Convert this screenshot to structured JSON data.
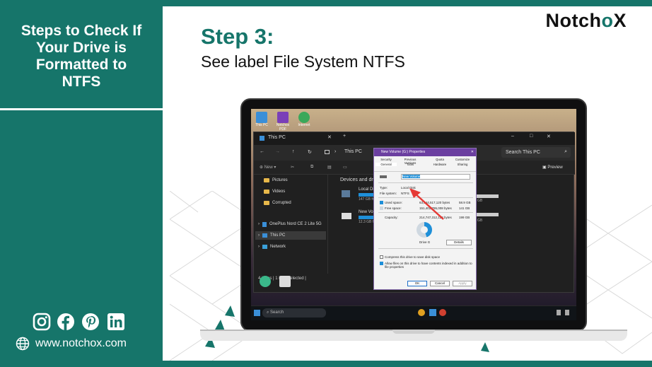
{
  "sidebar": {
    "title_lines": [
      "Steps to Check If",
      "Your Drive is",
      "Formatted to",
      "NTFS"
    ],
    "social_icons": [
      "instagram-icon",
      "facebook-icon",
      "pinterest-icon",
      "linkedin-icon"
    ],
    "website": "www.notchox.com"
  },
  "logo": {
    "text_left": "Notch",
    "text_o": "o",
    "text_right": "X"
  },
  "step": {
    "heading": "Step 3:",
    "subtitle": "See label File System NTFS"
  },
  "colors": {
    "brand": "#16756a",
    "dialog_accent": "#6b3fa0",
    "arrow": "#e53935"
  },
  "screenshot": {
    "desktop_icons": [
      "This PC",
      "Notchox PDF Editor",
      "Internet"
    ],
    "explorer": {
      "tab_title": "This PC",
      "address": "This PC",
      "search_placeholder": "Search This PC",
      "toolbar_new": "New",
      "preview_label": "Preview",
      "sidebar_items": [
        "Pictures",
        "Videos",
        "Corrupted",
        "OnePlus Nord CE 2 Lite 5G",
        "This PC",
        "Network"
      ],
      "section_header": "Devices and drives",
      "drives": [
        {
          "name": "Local Disk",
          "size": "147 GB free of ...",
          "right": "GB"
        },
        {
          "name": "New Volume",
          "size": "12.3 GB free of ...",
          "right": "GB"
        }
      ],
      "status": "4 items  |  1 item selected  |"
    },
    "dialog": {
      "title": "New Volume (G:) Properties",
      "tabs_row1": [
        "Security",
        "Previous Versions",
        "Quota",
        "Customize"
      ],
      "tabs_row2": [
        "General",
        "Tools",
        "Hardware",
        "Sharing"
      ],
      "name_value": "New Volume",
      "type_label": "Type:",
      "type_value": "Local Disk",
      "fs_label": "File system:",
      "fs_value": "NTFS",
      "used_label": "Used space:",
      "used_bytes": "63,344,517,120 bytes",
      "used_gb": "58.9 GB",
      "free_label": "Free space:",
      "free_bytes": "151,402,795,008 bytes",
      "free_gb": "141 GB",
      "capacity_label": "Capacity:",
      "capacity_bytes": "214,747,312,128 bytes",
      "capacity_gb": "199 GB",
      "drive_label": "Drive G",
      "details_button": "Details",
      "compress_label": "Compress this drive to save disk space",
      "index_label": "Allow files on this drive to have contents indexed in addition to file properties",
      "ok_button": "OK",
      "cancel_button": "Cancel",
      "apply_button": "Apply",
      "used_fraction": 0.45
    },
    "taskbar": {
      "search_placeholder": "Search"
    }
  }
}
